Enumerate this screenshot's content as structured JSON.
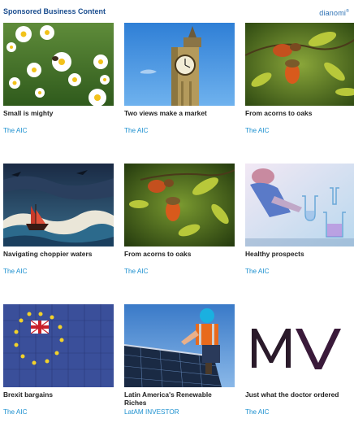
{
  "header": {
    "title": "Sponsored Business Content",
    "brand": "dianomi",
    "brand_mark": "®"
  },
  "cards": [
    {
      "image": "daisies-photo",
      "title": "Small is mighty",
      "source": "The AIC"
    },
    {
      "image": "big-ben-photo",
      "title": "Two views make a market",
      "source": "The AIC"
    },
    {
      "image": "acorns-photo",
      "title": "From acorns to oaks",
      "source": "The AIC"
    },
    {
      "image": "ship-in-storm-illustration",
      "title": "Navigating choppier waters",
      "source": "The AIC"
    },
    {
      "image": "acorns-photo",
      "title": "From acorns to oaks",
      "source": "The AIC"
    },
    {
      "image": "laboratory-photo",
      "title": "Healthy prospects",
      "source": "The AIC"
    },
    {
      "image": "eu-flag-puzzle-photo",
      "title": "Brexit bargains",
      "source": "The AIC"
    },
    {
      "image": "solar-panel-worker-photo",
      "title": "Latin America's Renewable Riches",
      "source": "LatAM INVESTOR"
    },
    {
      "image": "mv-logo",
      "title": "Just what the doctor ordered",
      "source": "The AIC"
    }
  ],
  "colors": {
    "header": "#1a4d8f",
    "source_link": "#1a8fcf",
    "title": "#222222"
  }
}
